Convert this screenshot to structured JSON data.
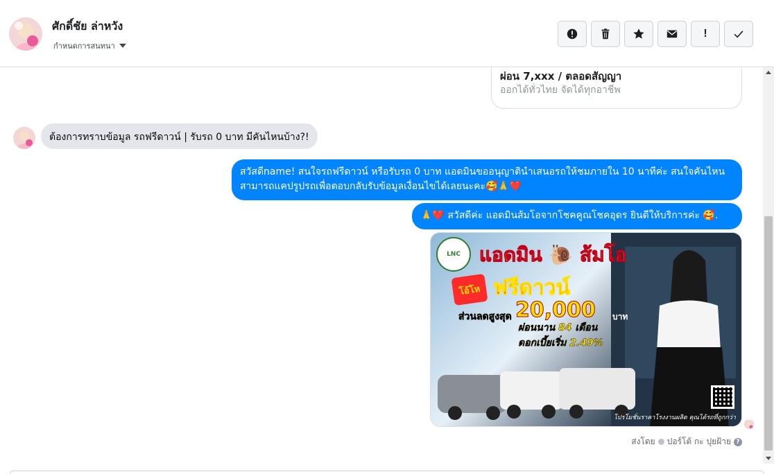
{
  "header": {
    "contact_name": "ศักดิ์ชัย ล่าหวัง",
    "assign_label": "กำหนดการสนทนา",
    "actions": [
      {
        "name": "mark-spam-button",
        "icon": "alert-circle-icon"
      },
      {
        "name": "delete-button",
        "icon": "trash-icon"
      },
      {
        "name": "star-button",
        "icon": "star-icon"
      },
      {
        "name": "mark-unread-button",
        "icon": "envelope-icon"
      },
      {
        "name": "follow-up-button",
        "icon": "exclamation-icon",
        "glyph": "!"
      },
      {
        "name": "mark-done-button",
        "icon": "checkmark-icon"
      }
    ]
  },
  "conversation": {
    "card": {
      "title": "ผ่อน 7,xxx / ตลอดสัญญา",
      "subtitle": "ออกได้ทั่วไทย จัดได้ทุกอาชีพ"
    },
    "incoming_message": "ต้องการทราบข้อมูล รถฟรีดาวน์ | รับรถ 0 บาท มีคันไหนบ้าง?!",
    "outgoing_messages": [
      "สวัสดีname! สนใจรถฟรีดาวน์ หรือรับรถ 0 บาท แอดมินขออนุญาตินำเสนอรถให้ชมภายใน 10 นาทีค่ะ สนใจคันไหนสามารถแคปรูปรถเพื่อตอบกลับรับข้อมูลเงื่อนไขได้เลยนะคะ🥰🙏❤️",
      "🙏❤️ สวัสดีค่ะ แอดมินส้มโอจากโชคคูณโชคอุดร ยินดีให้บริการค่ะ 🥰."
    ],
    "ad_image": {
      "headline": "แอดมิน 🐌 ส้มโอ",
      "promo": "โอ้โห",
      "free_down": "ฟรีดาวน์",
      "discount_label": "ส่วนลดสูงสุด",
      "discount_amount": "20,000",
      "currency": "บาท",
      "installment": "ผ่อนนาน 84 เดือน",
      "interest": "ดอกเบี้ยเริ่ม 2.49%",
      "footer": "โปรโมชั่นราคาโรงงานผลิต คุณได้รถที่ถูกกว่า",
      "logo_text": "LNC"
    },
    "sent_by_prefix": "ส่งโดย",
    "sent_by_name": "ปอร์โต้ กะ ปุยฝ้าย",
    "help_glyph": "?"
  },
  "colors": {
    "outgoing_bubble": "#0084ff",
    "incoming_bubble": "#e4e6eb",
    "border": "#dadde1"
  }
}
